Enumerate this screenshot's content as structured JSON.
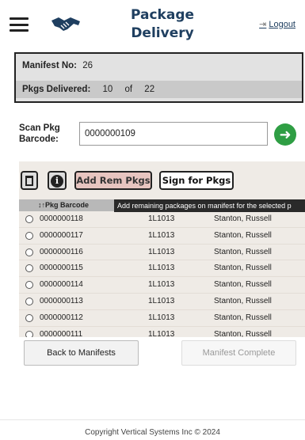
{
  "header": {
    "title": "Package Delivery",
    "logout_label": "Logout",
    "logout_icon": "sign-out-icon",
    "menu_icon": "hamburger-menu-icon",
    "logo_icon": "handshake-icon"
  },
  "manifest": {
    "manifest_no_label": "Manifest No:",
    "manifest_no": "26",
    "delivered_label": "Pkgs Delivered:",
    "delivered": "10",
    "of_label": "of",
    "total": "22"
  },
  "scan": {
    "label": "Scan Pkg Barcode:",
    "value": "0000000109",
    "go_icon": "arrow-right-circle-icon"
  },
  "toolbar": {
    "trash_icon": "trash-icon",
    "info_icon": "info-icon",
    "info_glyph": "i",
    "add_rem_label": "Add Rem Pkgs",
    "sign_label": "Sign for Pkgs",
    "tooltip": "Add remaining packages on manifest for the selected p"
  },
  "grid": {
    "header": "↕↑Pkg Barcode",
    "rows": [
      {
        "barcode": "0000000118",
        "code": "1L1013",
        "name": "Stanton, Russell"
      },
      {
        "barcode": "0000000117",
        "code": "1L1013",
        "name": "Stanton, Russell"
      },
      {
        "barcode": "0000000116",
        "code": "1L1013",
        "name": "Stanton, Russell"
      },
      {
        "barcode": "0000000115",
        "code": "1L1013",
        "name": "Stanton, Russell"
      },
      {
        "barcode": "0000000114",
        "code": "1L1013",
        "name": "Stanton, Russell"
      },
      {
        "barcode": "0000000113",
        "code": "1L1013",
        "name": "Stanton, Russell"
      },
      {
        "barcode": "0000000112",
        "code": "1L1013",
        "name": "Stanton, Russell"
      },
      {
        "barcode": "0000000111",
        "code": "1L1013",
        "name": "Stanton, Russell"
      }
    ]
  },
  "actions": {
    "back_label": "Back to Manifests",
    "complete_label": "Manifest Complete"
  },
  "footer": {
    "copyright": "Copyright Vertical Systems Inc © 2024"
  },
  "colors": {
    "title": "#1f3f60",
    "go_button": "#2f9e44",
    "add_rem_button": "#e7c5c0"
  }
}
